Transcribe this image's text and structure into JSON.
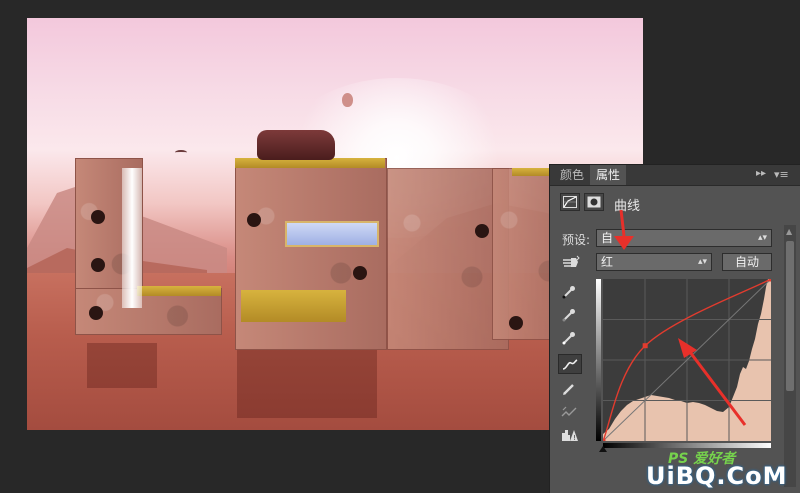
{
  "panel": {
    "tabs": [
      {
        "label": "颜色",
        "active": false
      },
      {
        "label": "属性",
        "active": true
      }
    ],
    "icons": {
      "collapse": "double-chevron-right-icon",
      "menu": "panel-menu-icon"
    },
    "header": {
      "title": "曲线",
      "adjustment_icon": "curves-adjustment-icon",
      "mask_icon": "layer-mask-icon"
    },
    "preset": {
      "label": "预设:",
      "value": "自"
    },
    "channel": {
      "value": "红",
      "auto_label": "自动",
      "hand_icon": "targeted-adjustment-hand-icon"
    },
    "tools": [
      "black-point-eyedropper-icon",
      "gray-point-eyedropper-icon",
      "white-point-eyedropper-icon",
      "curve-edit-icon",
      "pencil-icon",
      "smooth-curve-icon",
      "clipping-warning-icon"
    ],
    "curve": {
      "channel_color": "#e23b2e",
      "points": [
        [
          0,
          0
        ],
        [
          64,
          150
        ],
        [
          255,
          255
        ]
      ]
    }
  },
  "watermark": {
    "line1": "PS 爱好者",
    "line2": "UiBQ.CoM"
  },
  "colors": {
    "annotation_arrow": "#e8302a",
    "panel_bg": "#535353",
    "workspace_bg": "#282828"
  }
}
